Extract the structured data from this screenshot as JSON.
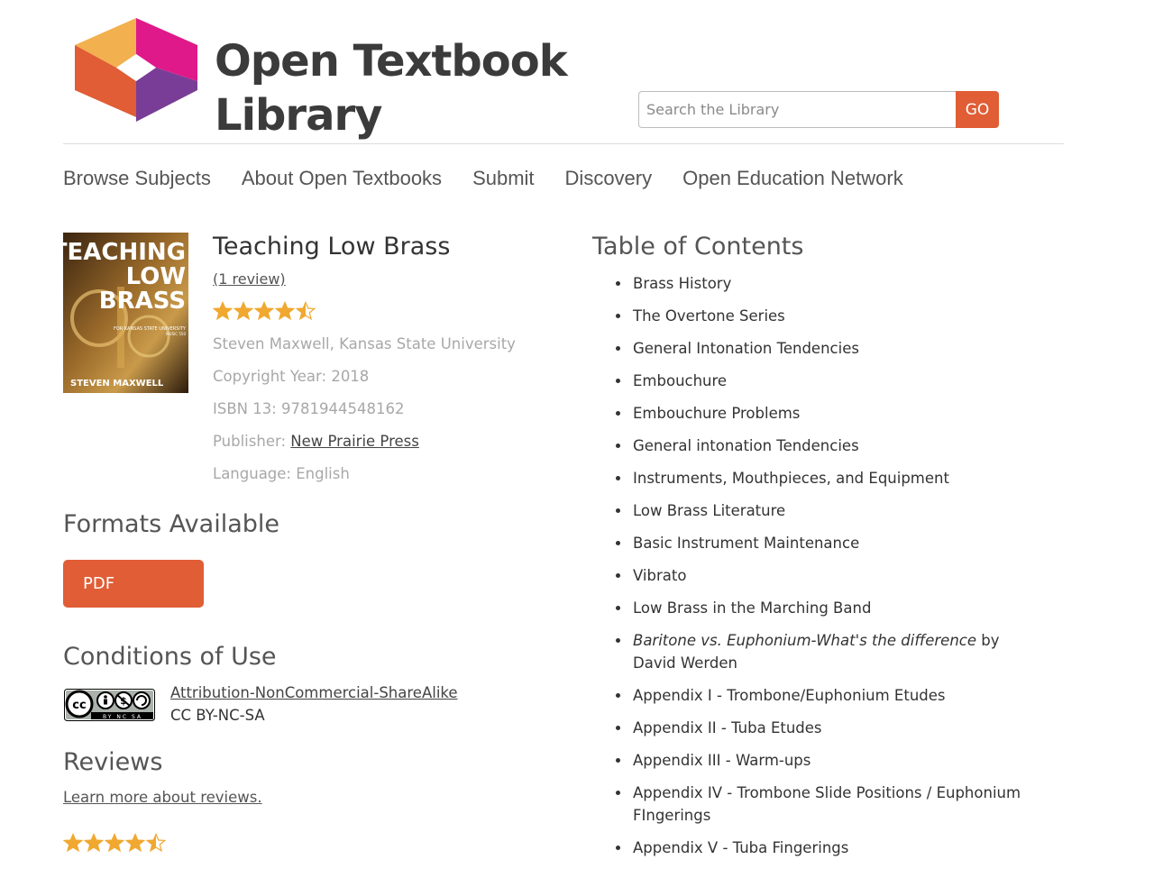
{
  "site": {
    "logo_line1": "Open Textbook",
    "logo_line2": "Library",
    "logo_colors": [
      "#f2b04e",
      "#e0198a",
      "#e05d35",
      "#7a3d97"
    ]
  },
  "search": {
    "placeholder": "Search the Library",
    "value": "",
    "go_label": "GO"
  },
  "nav": {
    "items": [
      {
        "label": "Browse Subjects"
      },
      {
        "label": "About Open Textbooks"
      },
      {
        "label": "Submit"
      },
      {
        "label": "Discovery"
      },
      {
        "label": "Open Education Network"
      }
    ]
  },
  "book": {
    "cover_title_1": "TEACHING",
    "cover_title_2": "LOW",
    "cover_title_3": "BRASS",
    "cover_subtitle": "FOR KANSAS STATE UNIVERSITY",
    "cover_course": "MUSIC 550",
    "cover_author": "STEVEN MAXWELL",
    "title": "Teaching Low Brass",
    "review_link": "(1 review)",
    "rating": 4.5,
    "author_line": "Steven Maxwell, Kansas State University",
    "copyright": "Copyright Year: 2018",
    "isbn": "ISBN 13: 9781944548162",
    "publisher_label": "Publisher:",
    "publisher_name": "New Prairie Press",
    "language": "Language: English"
  },
  "formats": {
    "title": "Formats Available",
    "pdf_label": "PDF"
  },
  "conditions": {
    "title": "Conditions of Use",
    "license_name": "Attribution-NonCommercial-ShareAlike",
    "license_code": "CC BY-NC-SA",
    "badge_text": "BY NC SA"
  },
  "reviews": {
    "title": "Reviews",
    "learn_more": "Learn more about reviews.",
    "rating": 4.5
  },
  "toc": {
    "title": "Table of Contents",
    "items": [
      {
        "text": "Brass History"
      },
      {
        "text": "The Overtone Series"
      },
      {
        "text": "General Intonation Tendencies"
      },
      {
        "text": "Embouchure"
      },
      {
        "text": "Embouchure Problems"
      },
      {
        "text": "General intonation Tendencies"
      },
      {
        "text": "Instruments, Mouthpieces, and Equipment"
      },
      {
        "text": "Low Brass Literature"
      },
      {
        "text": "Basic Instrument Maintenance"
      },
      {
        "text": "Vibrato"
      },
      {
        "text": "Low Brass in the Marching Band"
      },
      {
        "italic": "Baritone vs. Euphonium-What's the difference",
        "text": " by David Werden"
      },
      {
        "text": "Appendix I - Trombone/Euphonium Etudes"
      },
      {
        "text": "Appendix II - Tuba Etudes"
      },
      {
        "text": "Appendix III - Warm-ups"
      },
      {
        "text": "Appendix IV - Trombone Slide Positions / Euphonium FIngerings"
      },
      {
        "text": "Appendix V - Tuba Fingerings"
      }
    ]
  },
  "colors": {
    "accent": "#e05d35",
    "star": "#f0a830",
    "muted_text": "#a8a8a8"
  }
}
